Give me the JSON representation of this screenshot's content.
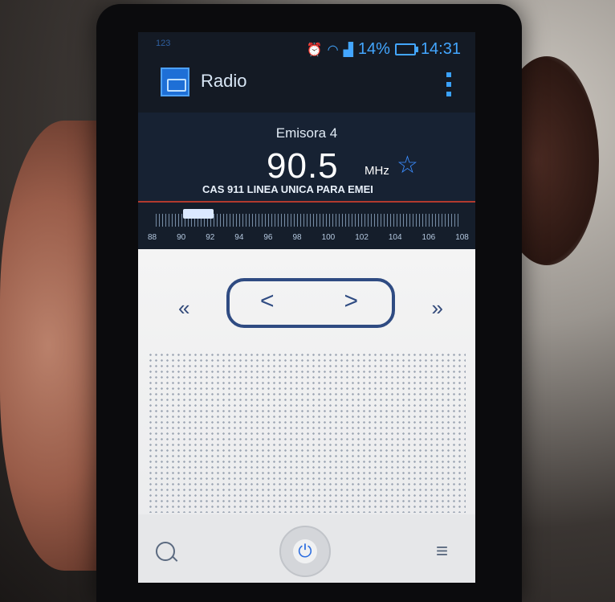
{
  "status_bar": {
    "left_text": "123",
    "battery_percent": "14%",
    "time": "14:31",
    "icons": [
      "alarm-icon",
      "wifi-icon",
      "signal-icon",
      "battery-icon"
    ],
    "accent": "#43a6ff"
  },
  "app_bar": {
    "title": "Radio",
    "icon": "radio-app-icon",
    "menu_icon": "overflow-menu-icon"
  },
  "station": {
    "name": "Emisora 4",
    "frequency": "90.5",
    "unit": "MHz",
    "rds_text": "CAS  911 LINEA UNICA PARA EMEI",
    "favorite_icon": "star-icon"
  },
  "scale": {
    "labels": [
      "88",
      "90",
      "92",
      "94",
      "96",
      "98",
      "100",
      "102",
      "104",
      "106",
      "108"
    ],
    "current": 90.5
  },
  "controls": {
    "seek_back": "«",
    "seek_forward": "»",
    "tune_prev": "<",
    "tune_next": ">"
  },
  "bottom_bar": {
    "search_icon": "search-icon",
    "power_icon": "power-icon",
    "list_icon": "station-list-icon",
    "power_glyph": "⏻",
    "list_glyph": "≡"
  }
}
